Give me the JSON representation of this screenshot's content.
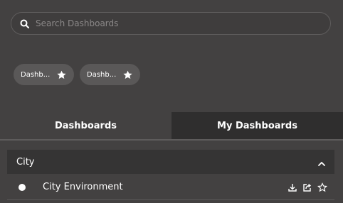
{
  "search": {
    "placeholder": "Search Dashboards",
    "value": ""
  },
  "favorites": [
    {
      "label": "Dashb..."
    },
    {
      "label": "Dashb..."
    }
  ],
  "tabs": [
    {
      "label": "Dashboards",
      "active": false
    },
    {
      "label": "My Dashboards",
      "active": true
    }
  ],
  "group": {
    "name": "City",
    "expanded": true,
    "items": [
      {
        "title": "City Environment"
      }
    ]
  },
  "icons": {
    "search": "search-icon",
    "star": "star-icon",
    "chevron": "chevron-up-icon",
    "download": "download-icon",
    "share": "share-icon",
    "favorite": "star-outline-icon"
  },
  "colors": {
    "background": "#434141",
    "active_tab": "#2f2e2e",
    "group_header": "#353434",
    "chip": "#5a5858",
    "text": "#ffffff"
  }
}
